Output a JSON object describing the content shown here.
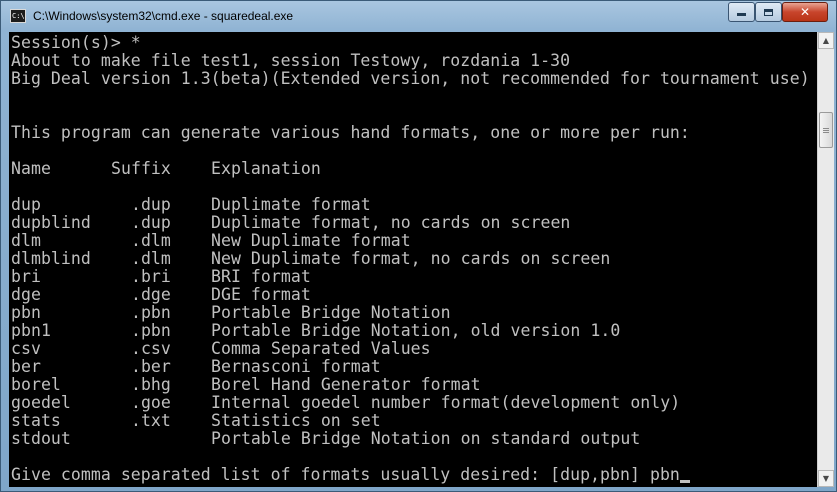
{
  "window": {
    "title": "C:\\Windows\\system32\\cmd.exe - squaredeal.exe",
    "icon_text": "C:\\",
    "buttons": {
      "minimize": "minimize-icon",
      "maximize": "maximize-icon",
      "close_label": "✕"
    }
  },
  "console": {
    "header_lines": [
      "Session(s)> *",
      "About to make file test1, session Testowy, rozdania 1-30",
      "Big Deal version 1.3(beta)(Extended version, not recommended for tournament use)",
      "",
      "",
      "This program can generate various hand formats, one or more per run:",
      ""
    ],
    "table_header": {
      "name": "Name",
      "suffix": "Suffix",
      "explanation": "Explanation"
    },
    "formats": [
      {
        "name": "dup",
        "suffix": "  .dup",
        "explanation": "Duplimate format"
      },
      {
        "name": "dupblind",
        "suffix": "  .dup",
        "explanation": "Duplimate format, no cards on screen"
      },
      {
        "name": "dlm",
        "suffix": "  .dlm",
        "explanation": "New Duplimate format"
      },
      {
        "name": "dlmblind",
        "suffix": "  .dlm",
        "explanation": "New Duplimate format, no cards on screen"
      },
      {
        "name": "bri",
        "suffix": "  .bri",
        "explanation": "BRI format"
      },
      {
        "name": "dge",
        "suffix": "  .dge",
        "explanation": "DGE format"
      },
      {
        "name": "pbn",
        "suffix": "  .pbn",
        "explanation": "Portable Bridge Notation"
      },
      {
        "name": "pbn1",
        "suffix": "  .pbn",
        "explanation": "Portable Bridge Notation, old version 1.0"
      },
      {
        "name": "csv",
        "suffix": "  .csv",
        "explanation": "Comma Separated Values"
      },
      {
        "name": "ber",
        "suffix": "  .ber",
        "explanation": "Bernasconi format"
      },
      {
        "name": "borel",
        "suffix": "  .bhg",
        "explanation": "Borel Hand Generator format"
      },
      {
        "name": "goedel",
        "suffix": "  .goe",
        "explanation": "Internal goedel number format(development only)"
      },
      {
        "name": "stats",
        "suffix": "  .txt",
        "explanation": "Statistics on set"
      },
      {
        "name": "stdout",
        "suffix": "",
        "explanation": "Portable Bridge Notation on standard output"
      }
    ],
    "prompt": "Give comma separated list of formats usually desired: [dup,pbn] ",
    "input_value": "pbn"
  },
  "scrollbar": {
    "up_icon": "▲",
    "down_icon": "▼"
  }
}
